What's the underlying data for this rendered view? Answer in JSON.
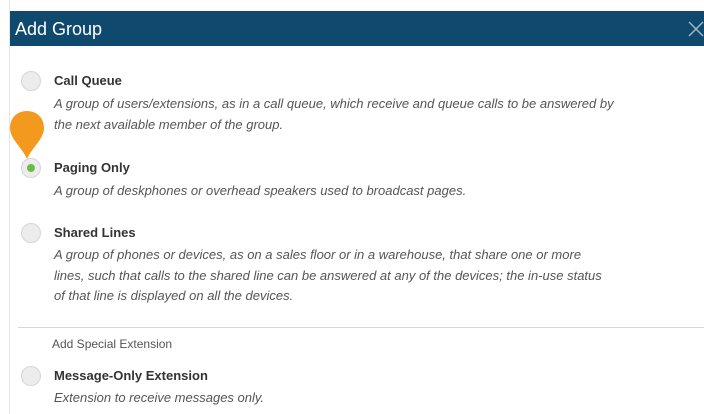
{
  "dialog": {
    "title": "Add Group",
    "close_icon": "close-icon"
  },
  "options": [
    {
      "title": "Call Queue",
      "description": "A group of users/extensions, as in a call queue, which receive and queue calls to be answered by the next available member of the group.",
      "selected": false
    },
    {
      "title": "Paging Only",
      "description": "A group of deskphones or overhead speakers used to broadcast pages.",
      "selected": true
    },
    {
      "title": "Shared Lines",
      "description": "A group of phones or devices, as on a sales floor or in a warehouse, that share one or more lines, such that calls to the shared line can be answered at any of the devices; the in-use status of that line is displayed on all the devices.",
      "selected": false
    }
  ],
  "special": {
    "section_label": "Add Special Extension",
    "options": [
      {
        "title": "Message-Only Extension",
        "description": "Extension to receive messages only.",
        "selected": false
      }
    ]
  },
  "colors": {
    "header_bg": "#0f4a6e",
    "selected_dot": "#6cbb45",
    "pin": "#f39a1e"
  }
}
